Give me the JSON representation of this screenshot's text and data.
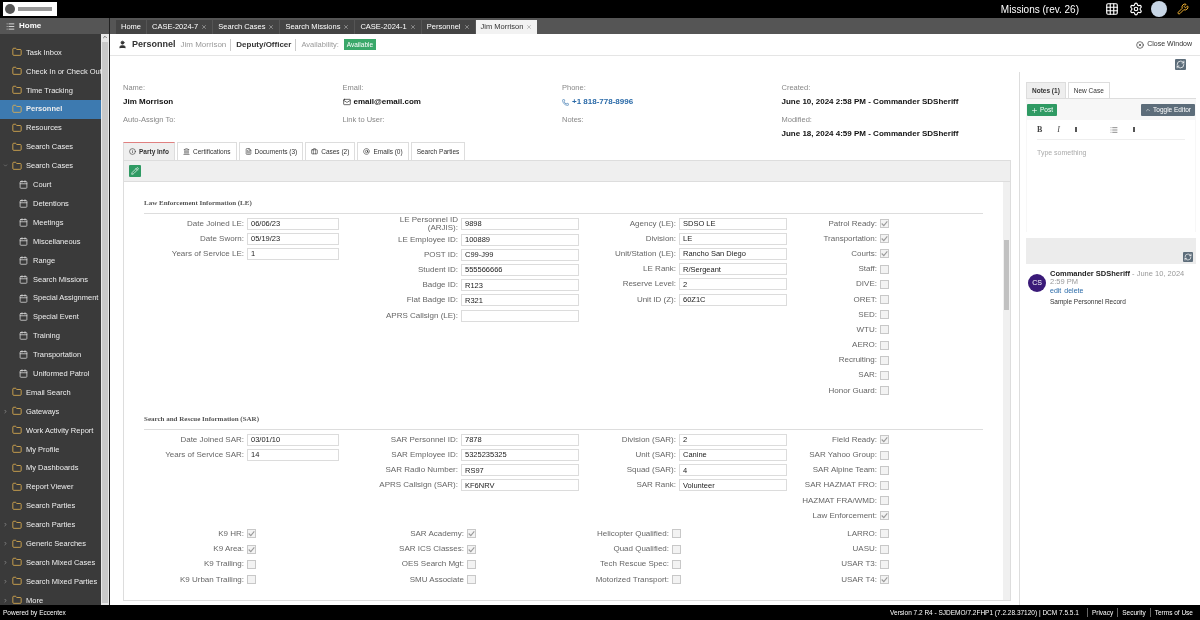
{
  "top_bar": {
    "title": "Missions (rev. 26)"
  },
  "sidebar": {
    "header": "Home",
    "items": [
      {
        "label": "Task Inbox",
        "expandable": false,
        "selected": false
      },
      {
        "label": "Check In or Check Out",
        "expandable": false,
        "selected": false
      },
      {
        "label": "Time Tracking",
        "expandable": false,
        "selected": false
      },
      {
        "label": "Personnel",
        "expandable": false,
        "selected": true
      },
      {
        "label": "Resources",
        "expandable": false,
        "selected": false
      },
      {
        "label": "Search Cases",
        "expandable": false,
        "selected": false
      },
      {
        "label": "Search Cases",
        "expandable": true,
        "expanded": true,
        "selected": false,
        "children": [
          {
            "label": "Court",
            "selected": false
          },
          {
            "label": "Detentions",
            "selected": false
          },
          {
            "label": "Meetings",
            "selected": false
          },
          {
            "label": "Miscellaneous",
            "selected": false
          },
          {
            "label": "Range",
            "selected": false
          },
          {
            "label": "Search Missions",
            "selected": false
          },
          {
            "label": "Special Assignment",
            "selected": false
          },
          {
            "label": "Special Event",
            "selected": false
          },
          {
            "label": "Training",
            "selected": false
          },
          {
            "label": "Transportation",
            "selected": false
          },
          {
            "label": "Uniformed Patrol",
            "selected": false
          }
        ]
      },
      {
        "label": "Email Search",
        "expandable": false,
        "selected": false
      },
      {
        "label": "Gateways",
        "expandable": true,
        "expanded": false,
        "selected": false
      },
      {
        "label": "Work Activity Report",
        "expandable": false,
        "selected": false
      },
      {
        "label": "My Profile",
        "expandable": false,
        "selected": false
      },
      {
        "label": "My Dashboards",
        "expandable": false,
        "selected": false
      },
      {
        "label": "Report Viewer",
        "expandable": false,
        "selected": false
      },
      {
        "label": "Search Parties",
        "expandable": false,
        "selected": false
      },
      {
        "label": "Search Parties",
        "expandable": true,
        "expanded": false,
        "selected": false
      },
      {
        "label": "Generic Searches",
        "expandable": true,
        "expanded": false,
        "selected": false
      },
      {
        "label": "Search Mixed Cases",
        "expandable": true,
        "expanded": false,
        "selected": false
      },
      {
        "label": "Search Mixed Parties",
        "expandable": true,
        "expanded": false,
        "selected": false
      },
      {
        "label": "More",
        "expandable": true,
        "expanded": false,
        "selected": false
      }
    ]
  },
  "tabs": [
    {
      "label": "Home",
      "closable": false,
      "selected": false
    },
    {
      "label": "CASE-2024-7",
      "closable": true,
      "selected": false
    },
    {
      "label": "Search Cases",
      "closable": true,
      "selected": false
    },
    {
      "label": "Search Missions",
      "closable": true,
      "selected": false
    },
    {
      "label": "CASE-2024-1",
      "closable": true,
      "selected": false
    },
    {
      "label": "Personnel",
      "closable": true,
      "selected": false
    },
    {
      "label": "Jim Morrison",
      "closable": true,
      "selected": true
    }
  ],
  "record": {
    "type": "Personnel",
    "name": "Jim Morrison",
    "role": "Deputy/Officer",
    "availability_label": "Availability:",
    "availability": "Available",
    "close": "Close Window"
  },
  "info": [
    {
      "label": "Name:",
      "value": "Jim Morrison",
      "kind": "text"
    },
    {
      "label": "Email:",
      "value": "email@email.com",
      "kind": "email"
    },
    {
      "label": "Phone:",
      "value": "+1 818-778-8996",
      "kind": "phone"
    },
    {
      "label": "Created:",
      "value": "June 10, 2024 2:58 PM - Commander SDSheriff",
      "kind": "text"
    },
    {
      "label": "Auto-Assign To:"
    },
    {
      "label": "Link to User:"
    },
    {
      "label": "Notes:"
    },
    {
      "label": "Modified:",
      "value": "June 18, 2024 4:59 PM - Commander SDSheriff",
      "kind": "text"
    }
  ],
  "detail_tabs": [
    {
      "label": "Party Info",
      "kind": "info",
      "selected": true
    },
    {
      "label": "Certifications",
      "kind": "certifications",
      "selected": false
    },
    {
      "label": "Documents (3)",
      "kind": "documents",
      "selected": false
    },
    {
      "label": "Cases (2)",
      "kind": "cases",
      "selected": false
    },
    {
      "label": "Emails (0)",
      "kind": "emails",
      "selected": false
    },
    {
      "label": "Search Parties",
      "kind": "plain",
      "selected": false
    }
  ],
  "sections": [
    {
      "title": "Law Enforcement Information (LE)",
      "columns": [
        [
          {
            "label": "Date Joined LE:",
            "kind": "text",
            "value": "06/06/23"
          },
          {
            "label": "Date Sworn:",
            "kind": "text",
            "value": "05/19/23"
          },
          {
            "label": "Years of Service LE:",
            "kind": "text",
            "value": "1"
          }
        ],
        [
          {
            "label": "LE Personnel ID (ARJIS):",
            "kind": "text",
            "value": "9898"
          },
          {
            "label": "LE Employee ID:",
            "kind": "text",
            "value": "100889"
          },
          {
            "label": "POST ID:",
            "kind": "text",
            "value": "C99-J99"
          },
          {
            "label": "Student ID:",
            "kind": "text",
            "value": "555566666"
          },
          {
            "label": "Badge ID:",
            "kind": "text",
            "value": "R123"
          },
          {
            "label": "Flat Badge ID:",
            "kind": "text",
            "value": "R321"
          },
          {
            "label": "APRS Callsign (LE):",
            "kind": "text"
          }
        ],
        [
          {
            "label": "Agency (LE):",
            "kind": "text",
            "value": "SDSO LE"
          },
          {
            "label": "Division:",
            "kind": "text",
            "value": "LE"
          },
          {
            "label": "Unit/Station (LE):",
            "kind": "text",
            "value": "Rancho San Diego"
          },
          {
            "label": "LE Rank:",
            "kind": "text",
            "value": "R/Sergeant"
          },
          {
            "label": "Reserve Level:",
            "kind": "text",
            "value": "2"
          },
          {
            "label": "Unit ID (Z):",
            "kind": "text",
            "value": "60Z1C"
          }
        ],
        [
          {
            "label": "Patrol Ready:",
            "kind": "checkbox",
            "checked": true
          },
          {
            "label": "Transportation:",
            "kind": "checkbox",
            "checked": true
          },
          {
            "label": "Courts:",
            "kind": "checkbox",
            "checked": true
          },
          {
            "label": "Staff:",
            "kind": "checkbox",
            "checked": false
          },
          {
            "label": "DIVE:",
            "kind": "checkbox",
            "checked": false
          },
          {
            "label": "ORET:",
            "kind": "checkbox",
            "checked": false
          },
          {
            "label": "SED:",
            "kind": "checkbox",
            "checked": false
          },
          {
            "label": "WTU:",
            "kind": "checkbox",
            "checked": false
          },
          {
            "label": "AERO:",
            "kind": "checkbox",
            "checked": false
          },
          {
            "label": "Recruiting:",
            "kind": "checkbox",
            "checked": false
          },
          {
            "label": "SAR:",
            "kind": "checkbox",
            "checked": false
          },
          {
            "label": "Honor Guard:",
            "kind": "checkbox",
            "checked": false
          }
        ]
      ]
    },
    {
      "title": "Search and Rescue Information (SAR)",
      "columns": [
        [
          {
            "label": "Date Joined SAR:",
            "kind": "text",
            "value": "03/01/10"
          },
          {
            "label": "Years of Service SAR:",
            "kind": "text",
            "value": "14"
          }
        ],
        [
          {
            "label": "SAR Personnel ID:",
            "kind": "text",
            "value": "7878"
          },
          {
            "label": "SAR Employee ID:",
            "kind": "text",
            "value": "5325235325"
          },
          {
            "label": "SAR Radio Number:",
            "kind": "text",
            "value": "RS97"
          },
          {
            "label": "APRS Callsign (SAR):",
            "kind": "text",
            "value": "KF6NRV"
          }
        ],
        [
          {
            "label": "Division (SAR):",
            "kind": "text",
            "value": "2"
          },
          {
            "label": "Unit (SAR):",
            "kind": "text",
            "value": "Canine"
          },
          {
            "label": "Squad (SAR):",
            "kind": "text",
            "value": "4"
          },
          {
            "label": "SAR Rank:",
            "kind": "text",
            "value": "Volunteer"
          }
        ],
        [
          {
            "label": "Field Ready:",
            "kind": "checkbox",
            "checked": true
          },
          {
            "label": "SAR Yahoo Group:",
            "kind": "checkbox",
            "checked": false
          },
          {
            "label": "SAR Alpine Team:",
            "kind": "checkbox",
            "checked": false
          },
          {
            "label": "SAR HAZMAT FRO:",
            "kind": "checkbox",
            "checked": false
          },
          {
            "label": "HAZMAT FRA/WMD:",
            "kind": "checkbox",
            "checked": false
          },
          {
            "label": "Law Enforcement:",
            "kind": "checkbox",
            "checked": true
          }
        ]
      ],
      "extra_columns": [
        [
          {
            "label": "K9 HR:",
            "kind": "checkbox",
            "checked": true
          },
          {
            "label": "K9 Area:",
            "kind": "checkbox",
            "checked": true
          },
          {
            "label": "K9 Trailing:",
            "kind": "checkbox",
            "checked": false
          },
          {
            "label": "K9 Urban Trailing:",
            "kind": "checkbox",
            "checked": false
          }
        ],
        [
          {
            "label": "SAR Academy:",
            "kind": "checkbox",
            "checked": true
          },
          {
            "label": "SAR ICS Classes:",
            "kind": "checkbox",
            "checked": true
          },
          {
            "label": "OES Search Mgt:",
            "kind": "checkbox",
            "checked": false
          },
          {
            "label": "SMU Associate",
            "kind": "checkbox",
            "checked": false
          }
        ],
        [
          {
            "label": "Helicopter Qualified:",
            "kind": "checkbox",
            "checked": false
          },
          {
            "label": "Quad Qualified:",
            "kind": "checkbox",
            "checked": false
          },
          {
            "label": "Tech Rescue Spec:",
            "kind": "checkbox",
            "checked": false
          },
          {
            "label": "Motorized Transport:",
            "kind": "checkbox",
            "checked": false
          }
        ],
        [
          {
            "label": "LARRO:",
            "kind": "checkbox",
            "checked": false
          },
          {
            "label": "UASU:",
            "kind": "checkbox",
            "checked": false
          },
          {
            "label": "USAR T3:",
            "kind": "checkbox",
            "checked": false
          },
          {
            "label": "USAR T4:",
            "kind": "checkbox",
            "checked": true
          }
        ]
      ]
    }
  ],
  "notes": {
    "tabs": [
      {
        "label": "Notes (1)",
        "selected": true
      },
      {
        "label": "New Case",
        "selected": false
      }
    ],
    "post": "Post",
    "toggle": "Toggle Editor",
    "toolbar": [
      "B",
      "I"
    ],
    "placeholder": "Type something",
    "entries": [
      {
        "initials": "CS",
        "author": "Commander SDSheriff",
        "date": "- June 10, 2024 2:59 PM",
        "actions": [
          "edit",
          "delete"
        ],
        "text": "Sample Personnel Record"
      }
    ]
  },
  "status_bar": {
    "left": "Powered by Eccentex",
    "version": "Version",
    "version_value": "7.2 R4 - SJDEMO/7.2FHP1 (7.2.28.37120) | DCM 7.5.5.1",
    "links": [
      "Privacy",
      "Security",
      "Terms of Use"
    ]
  }
}
